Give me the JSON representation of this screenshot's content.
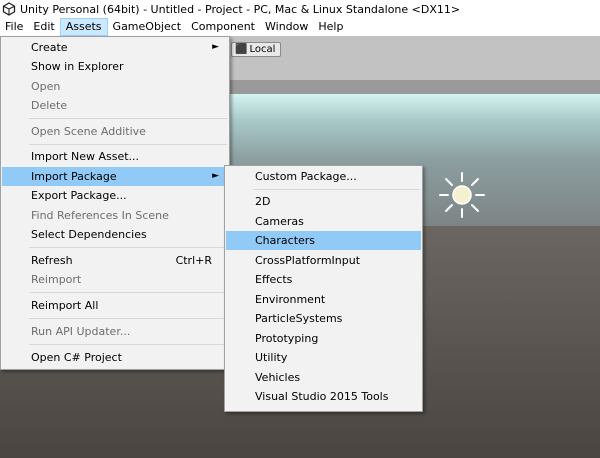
{
  "window": {
    "title": "Unity Personal (64bit) - Untitled - Project - PC, Mac & Linux Standalone <DX11>"
  },
  "menubar": [
    "File",
    "Edit",
    "Assets",
    "GameObject",
    "Component",
    "Window",
    "Help"
  ],
  "scene": {
    "local_label": "Local"
  },
  "assets_menu": [
    {
      "label": "Create",
      "submenu": true
    },
    {
      "label": "Show in Explorer"
    },
    {
      "label": "Open",
      "disabled": true
    },
    {
      "label": "Delete",
      "disabled": true
    },
    {
      "label": "Open Scene Additive",
      "disabled": true
    },
    {
      "label": "Import New Asset..."
    },
    {
      "label": "Import Package",
      "submenu": true,
      "highlighted": true
    },
    {
      "label": "Export Package..."
    },
    {
      "label": "Find References In Scene",
      "disabled": true
    },
    {
      "label": "Select Dependencies"
    },
    {
      "label": "Refresh",
      "shortcut": "Ctrl+R"
    },
    {
      "label": "Reimport",
      "disabled": true
    },
    {
      "label": "Reimport All"
    },
    {
      "label": "Run API Updater...",
      "disabled": true
    },
    {
      "label": "Open C# Project"
    }
  ],
  "import_package_menu": [
    {
      "label": "Custom Package..."
    },
    {
      "label": "2D"
    },
    {
      "label": "Cameras"
    },
    {
      "label": "Characters",
      "highlighted": true
    },
    {
      "label": "CrossPlatformInput"
    },
    {
      "label": "Effects"
    },
    {
      "label": "Environment"
    },
    {
      "label": "ParticleSystems"
    },
    {
      "label": "Prototyping"
    },
    {
      "label": "Utility"
    },
    {
      "label": "Vehicles"
    },
    {
      "label": "Visual Studio 2015 Tools"
    }
  ]
}
